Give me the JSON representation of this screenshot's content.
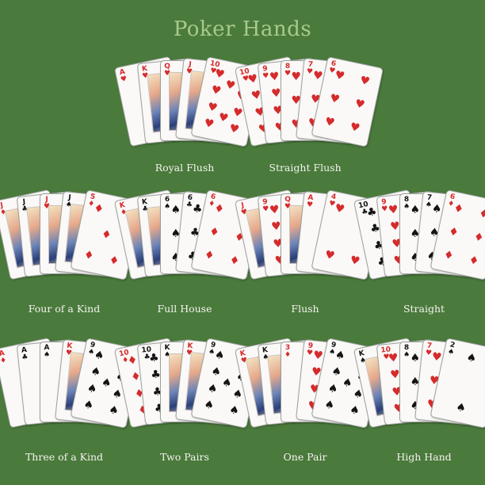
{
  "title": "Poker Hands",
  "hands": [
    {
      "label": "Royal Flush",
      "cards": [
        [
          "A",
          "h"
        ],
        [
          "K",
          "h"
        ],
        [
          "Q",
          "h"
        ],
        [
          "J",
          "h"
        ],
        [
          "10",
          "h"
        ]
      ]
    },
    {
      "label": "Straight Flush",
      "cards": [
        [
          "10",
          "h"
        ],
        [
          "9",
          "h"
        ],
        [
          "8",
          "h"
        ],
        [
          "7",
          "h"
        ],
        [
          "6",
          "h"
        ]
      ]
    },
    {
      "label": "Four of a Kind",
      "cards": [
        [
          "J",
          "d"
        ],
        [
          "J",
          "c"
        ],
        [
          "J",
          "h"
        ],
        [
          "J",
          "s"
        ],
        [
          "5",
          "d"
        ]
      ]
    },
    {
      "label": "Full House",
      "cards": [
        [
          "K",
          "d"
        ],
        [
          "K",
          "c"
        ],
        [
          "6",
          "s"
        ],
        [
          "6",
          "c"
        ],
        [
          "6",
          "d"
        ]
      ]
    },
    {
      "label": "Flush",
      "cards": [
        [
          "J",
          "h"
        ],
        [
          "9",
          "h"
        ],
        [
          "Q",
          "h"
        ],
        [
          "A",
          "h"
        ],
        [
          "4",
          "h"
        ]
      ]
    },
    {
      "label": "Straight",
      "cards": [
        [
          "10",
          "c"
        ],
        [
          "9",
          "h"
        ],
        [
          "8",
          "s"
        ],
        [
          "7",
          "s"
        ],
        [
          "6",
          "d"
        ]
      ]
    },
    {
      "label": "Three of a Kind",
      "cards": [
        [
          "A",
          "d"
        ],
        [
          "A",
          "c"
        ],
        [
          "A",
          "s"
        ],
        [
          "K",
          "h"
        ],
        [
          "9",
          "s"
        ]
      ]
    },
    {
      "label": "Two Pairs",
      "cards": [
        [
          "10",
          "d"
        ],
        [
          "10",
          "c"
        ],
        [
          "K",
          "s"
        ],
        [
          "K",
          "h"
        ],
        [
          "9",
          "s"
        ]
      ]
    },
    {
      "label": "One Pair",
      "cards": [
        [
          "K",
          "h"
        ],
        [
          "K",
          "s"
        ],
        [
          "3",
          "d"
        ],
        [
          "9",
          "h"
        ],
        [
          "9",
          "s"
        ]
      ]
    },
    {
      "label": "High Hand",
      "cards": [
        [
          "K",
          "s"
        ],
        [
          "10",
          "h"
        ],
        [
          "8",
          "s"
        ],
        [
          "7",
          "h"
        ],
        [
          "2",
          "s"
        ]
      ]
    }
  ],
  "colors": {
    "table": "#4a7a3c",
    "title": "#a9c98f",
    "red": "#d52b2b",
    "black": "#141414"
  }
}
